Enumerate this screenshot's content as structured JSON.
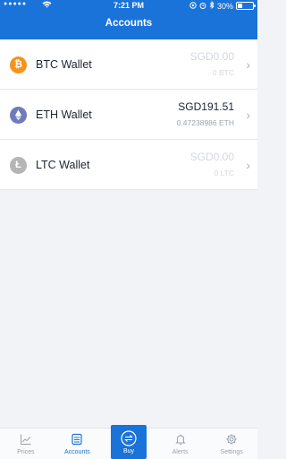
{
  "status_bar": {
    "signal": "●●●●●",
    "time": "7:21 PM",
    "battery": "30%",
    "battery_level": 0.3
  },
  "header": {
    "title": "Accounts"
  },
  "wallets": [
    {
      "name": "BTC Wallet",
      "fiat": "SGD0.00",
      "crypto": "0 BTC",
      "icon": "bitcoin-icon",
      "color": "#f7931a"
    },
    {
      "name": "ETH Wallet",
      "fiat": "SGD191.51",
      "crypto": "0.47238986 ETH",
      "icon": "ethereum-icon",
      "color": "#6f7cba"
    },
    {
      "name": "LTC Wallet",
      "fiat": "SGD0.00",
      "crypto": "0 LTC",
      "icon": "litecoin-icon",
      "color": "#b5b5b5"
    }
  ],
  "tabs": [
    {
      "label": "Prices",
      "icon": "chart-icon"
    },
    {
      "label": "Accounts",
      "icon": "wallet-icon"
    },
    {
      "label": "Buy",
      "icon": "exchange-icon"
    },
    {
      "label": "Alerts",
      "icon": "bell-icon"
    },
    {
      "label": "Settings",
      "icon": "gear-icon"
    }
  ],
  "colors": {
    "brand": "#1a73d9",
    "background": "#f1f3f6"
  }
}
